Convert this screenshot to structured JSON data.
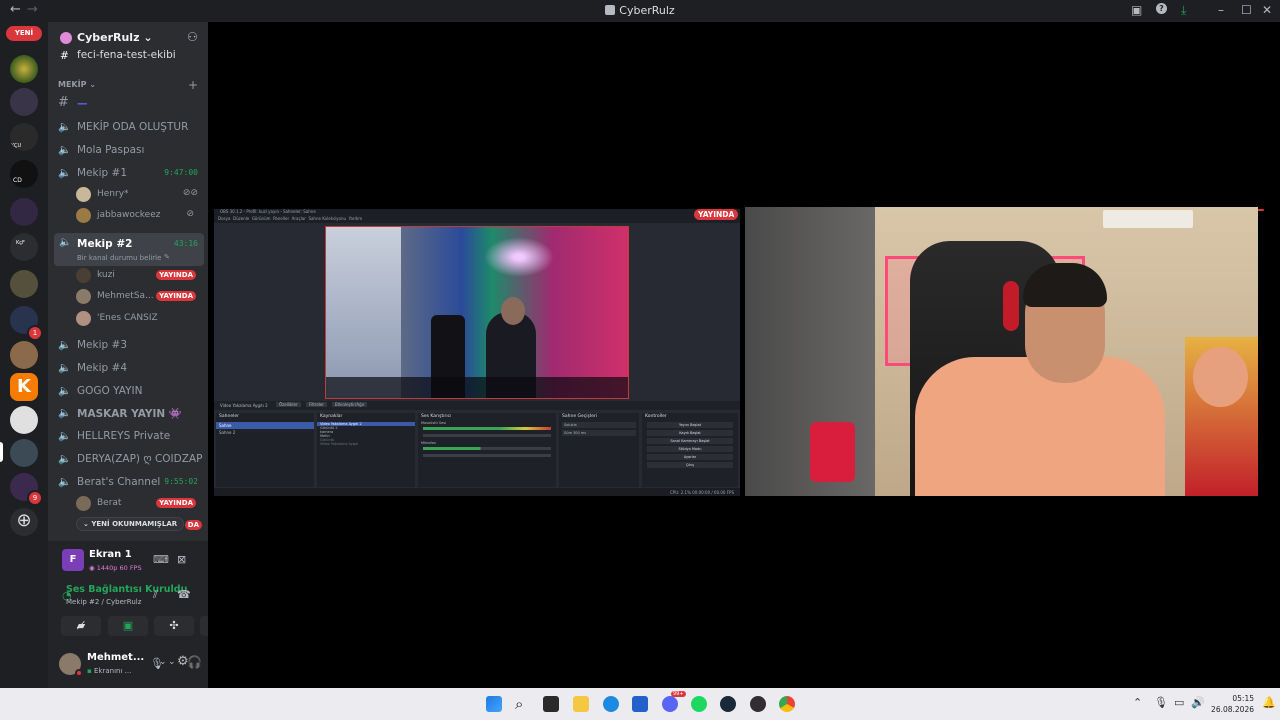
{
  "window": {
    "title": "CyberRulz"
  },
  "guilds": {
    "new_pill": "YENİ",
    "labels": [
      "KÇU",
      "CD",
      "KçF"
    ],
    "badges": [
      "1",
      "9"
    ]
  },
  "server": {
    "name": "CyberRulz"
  },
  "channels": {
    "top_partial": "feci-fena-test-ekibi",
    "category": "MEKİP",
    "items": [
      {
        "name": "—",
        "type": "text"
      },
      {
        "name": "MEKİP ODA OLUŞTUR",
        "type": "voice"
      },
      {
        "name": "Mola Paspası",
        "type": "voice"
      },
      {
        "name": "Mekip #1",
        "type": "voice",
        "time": "9:47:00"
      },
      {
        "name": "Mekip #2",
        "type": "voice",
        "time": "43:16",
        "status": "Bir kanal durumu belirle"
      },
      {
        "name": "Mekip #3",
        "type": "voice"
      },
      {
        "name": "Mekip #4",
        "type": "voice"
      },
      {
        "name": "GOGO YAYIN",
        "type": "voice"
      },
      {
        "name": "MASKAR YAYIN 👾",
        "type": "voice"
      },
      {
        "name": "HELLREYS Private",
        "type": "voice"
      },
      {
        "name": "DERYA(ZAP) ღ COIDZAP",
        "type": "voice"
      },
      {
        "name": "Berat's Channel",
        "type": "voice",
        "time": "9:55:02"
      }
    ],
    "users": [
      {
        "name": "Henry*"
      },
      {
        "name": "jabbawockeez"
      },
      {
        "name": "kuzi",
        "live": "YAYINDA"
      },
      {
        "name": "MehmetSa...",
        "live": "YAYINDA"
      },
      {
        "name": "'Enes CANSIZ"
      },
      {
        "name": "Berat",
        "live": "YAYINDA"
      }
    ],
    "unread_pill": "YENİ OKUNMAMIŞLAR",
    "unread_partial": "DA"
  },
  "stream_panel": {
    "title": "Ekran 1",
    "quality": "1440p 60 FPS",
    "avatar_letter": "F"
  },
  "voice_panel": {
    "status": "Ses Bağlantısı Kuruldu",
    "location": "Mekip #2 / CyberRulz"
  },
  "user_panel": {
    "name": "Mehmet...",
    "status": "Ekranını ..."
  },
  "stage": {
    "live_label": "YAYINDA"
  },
  "obs": {
    "titlebar": "OBS 30.1.2 - Profil: kuzi yayın - Sahneler: Sahne",
    "menu": [
      "Dosya",
      "Düzenle",
      "Görünüm",
      "Paneller",
      "Araçlar",
      "Sahne Koleksiyonu",
      "Yardım"
    ],
    "toolbar": [
      "Video Yakalama Aygıtı 2",
      "Özellikler",
      "Filtreler",
      "Etkinleştir/Ağır"
    ],
    "panels": [
      {
        "title": "Sahneler",
        "items": [
          "Sahne",
          "Sahne 2"
        ]
      },
      {
        "title": "Kaynaklar",
        "items": [
          "Video Yakalama Aygıtı 2",
          "Görüntü 2",
          "kamera",
          "Metin",
          "Görüntü",
          "Video Yakalama Aygıtı"
        ]
      },
      {
        "title": "Ses Karıştırıcı",
        "items": [
          "Masaüstü Sesi",
          "Mikrofon"
        ]
      },
      {
        "title": "Sahne Geçişleri",
        "items": [
          "Solukla",
          "Süre 300 ms"
        ]
      },
      {
        "title": "Kontroller",
        "items": [
          "Yayını Başlat",
          "Kaydı Başlat",
          "Sanal Kamerayı Başlat",
          "Stüdyo Modu",
          "Ayarlar",
          "Çıkış"
        ]
      }
    ],
    "status": "CPU: 2.1%   00:00:00 / 60.00 FPS"
  },
  "taskbar": {
    "time": "05:15",
    "date": "26.08.2026",
    "chat_badge": "99+"
  },
  "colors": {
    "accent_red": "#da373c",
    "green": "#23a55a",
    "blurple": "#5865f2",
    "bg_dark": "#1e1f22",
    "sidebar": "#2b2d31",
    "panel": "#232428"
  }
}
